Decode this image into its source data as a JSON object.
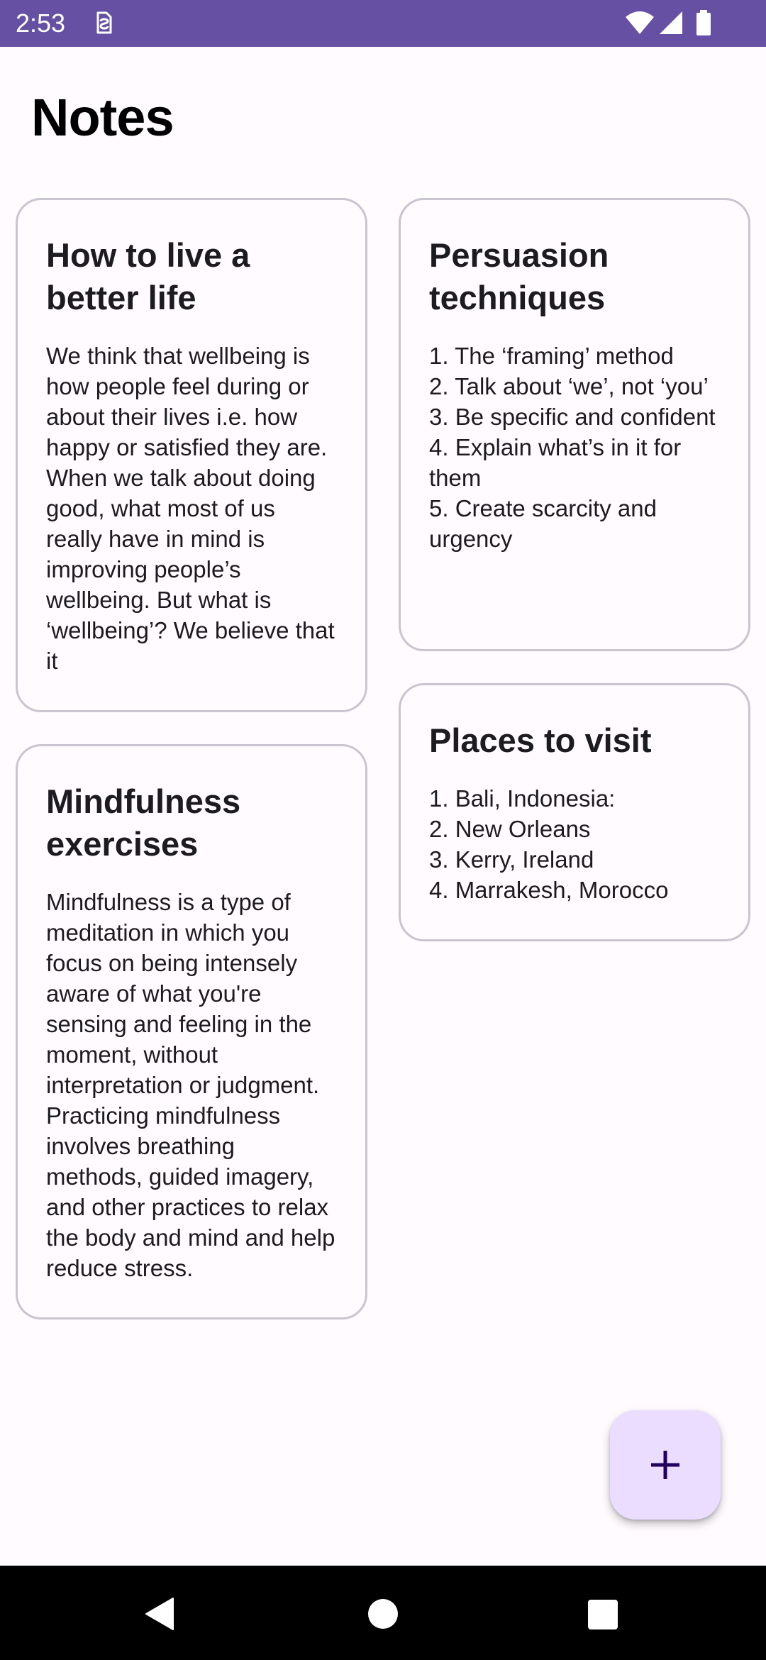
{
  "status_bar": {
    "time": "2:53",
    "background": "#6650a4",
    "icons": [
      "sim-icon",
      "wifi-icon",
      "signal-icon",
      "battery-icon"
    ]
  },
  "header": {
    "title": "Notes"
  },
  "notes": [
    {
      "title": "How to live a better life",
      "body": "We think that wellbeing is how people feel during or about their lives i.e. how happy or satisfied they are. When we talk about doing good, what most of us really have in mind is improving people’s wellbeing. But what is ‘wellbeing’? We believe that it"
    },
    {
      "title": "Persuasion techniques",
      "body": "1. The ‘framing’ method\n2. Talk about ‘we’, not ‘you’\n3. Be specific and confident\n4. Explain what’s in it for them\n5. Create scarcity and urgency"
    },
    {
      "title": "Mindfulness exercises",
      "body": "Mindfulness is a type of meditation in which you focus on being intensely aware of what you're sensing and feeling in the moment, without interpretation or judgment. Practicing mindfulness involves breathing methods, guided imagery, and other practices to relax the body and mind and help reduce stress."
    },
    {
      "title": "Places to visit",
      "body": "1. Bali, Indonesia:\n2. New Orleans\n3. Kerry, Ireland\n4. Marrakesh, Morocco"
    }
  ],
  "fab": {
    "icon": "plus-icon",
    "color": "#eaddff"
  },
  "nav_bar": {
    "icons": [
      "back-icon",
      "home-icon",
      "recents-icon"
    ]
  }
}
